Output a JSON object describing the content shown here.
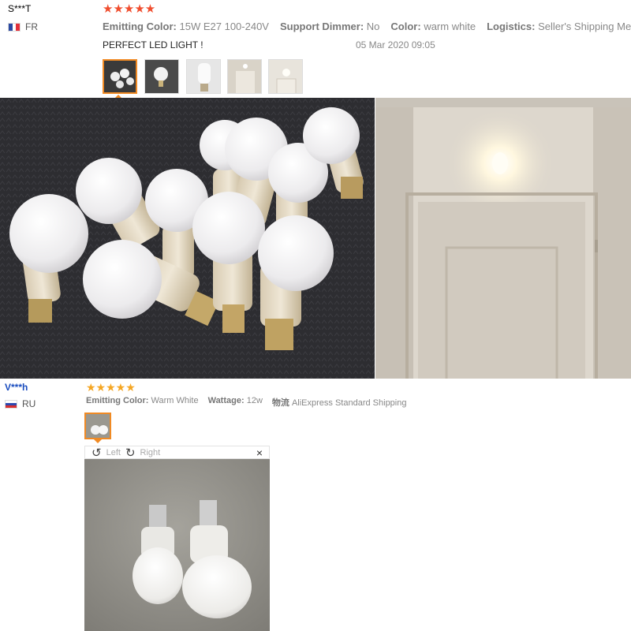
{
  "review1": {
    "user": "S***T",
    "country": "FR",
    "stars": "★★★★★",
    "attrs": [
      {
        "label": "Emitting Color:",
        "value": "15W E27 100-240V"
      },
      {
        "label": "Support Dimmer:",
        "value": "No"
      },
      {
        "label": "Color:",
        "value": "warm white"
      },
      {
        "label": "Logistics:",
        "value": "Seller's Shipping Method"
      }
    ],
    "text": "PERFECT LED LIGHT !",
    "date": "05 Mar 2020 09:05"
  },
  "review2": {
    "user": "V***h",
    "country": "RU",
    "stars": "★★★★★",
    "attrs": [
      {
        "label": "Emitting Color:",
        "value": "Warm White"
      },
      {
        "label": "Wattage:",
        "value": "12w"
      },
      {
        "label": "物流",
        "value": "AliExpress Standard Shipping"
      }
    ],
    "viewer": {
      "rotate_left_icon": "↺",
      "rotate_left": "Left",
      "rotate_right_icon": "↻",
      "rotate_right": "Right",
      "close": "×"
    }
  },
  "colors": {
    "star_red": "#f04d2e",
    "star_orange": "#f5a623",
    "selected_border": "#f08a24"
  }
}
